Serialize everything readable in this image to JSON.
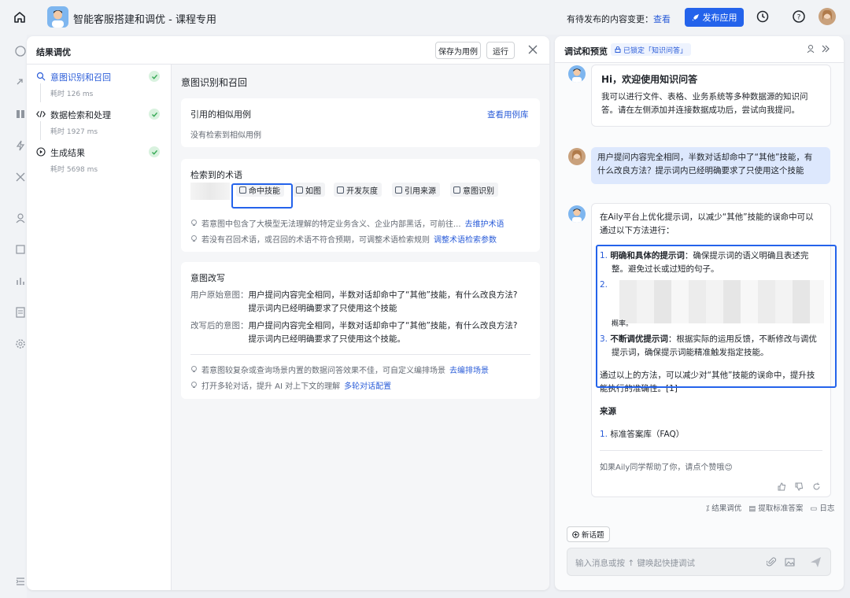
{
  "topbar": {
    "title": "智能客服搭建和调优 - 课程专用",
    "pending_label": "有待发布的内容变更：",
    "pending_link": "查看",
    "publish_label": "发布应用"
  },
  "left": {
    "title": "结果调优",
    "save_case": "保存为用例",
    "run": "运行",
    "steps": [
      {
        "label": "意图识别和召回",
        "time": "耗时 126 ms"
      },
      {
        "label": "数据检索和处理",
        "time": "耗时 1927 ms"
      },
      {
        "label": "生成结果",
        "time": "耗时 5698 ms"
      }
    ],
    "main_title": "意图识别和召回",
    "similar": {
      "title": "引用的相似用例",
      "link": "查看用例库",
      "empty": "没有检索到相似用例"
    },
    "terms": {
      "title": "检索到的术语",
      "tags": [
        "命中技能",
        "如图",
        "开发灰度",
        "引用来源",
        "意图识别"
      ],
      "tip1_text": "若意图中包含了大模型无法理解的特定业务含义、企业内部黑话，可前往...",
      "tip1_link": "去维护术语",
      "tip2_text": "若没有召回术语，或召回的术语不符合预期，可调整术语检索规则",
      "tip2_link": "调整术语检索参数"
    },
    "rewrite": {
      "title": "意图改写",
      "orig_label": "用户原始意图：",
      "orig_line1": "用户提问内容完全相同，半数对话却命中了“其他”技能，有什么改良方法?",
      "orig_line2": "提示词内已经明确要求了只使用这个技能",
      "new_label": "改写后的意图：",
      "new_line1": "用户提问内容完全相同，半数对话却命中了“其他”技能，有什么改良方法?",
      "new_line2": "提示词内已经明确要求了只使用这个技能。",
      "tip1_text": "若意图较复杂或查询场景内置的数据问答效果不佳，可自定义编排场景",
      "tip1_link": "去编排场景",
      "tip2_text": "打开多轮对话，提升 AI 对上下文的理解",
      "tip2_link": "多轮对话配置"
    }
  },
  "right": {
    "title": "调试和预览",
    "badge": "已锁定「知识问答」",
    "welcome_title": "Hi，欢迎使用知识问答",
    "welcome_l1": "我可以进行文件、表格、业务系统等多种数据源的知识问",
    "welcome_l2": "答。请在左侧添加并连接数据成功后，尝试向我提问。",
    "user_l1": "用户提问内容完全相同，半数对话却命中了“其他”技能，有",
    "user_l2": "什么改良方法？提示词内已经明确要求了只使用这个技能",
    "ans_l1": "在Aily平台上优化提示词，以减少“其他”技能的误命中可以",
    "ans_l2": "通过以下方法进行：",
    "item1_num": "1.",
    "item1_bold": "明确和具体的提示词",
    "item1_rest": "：确保提示词的语义明确且表述完",
    "item1_l2": "整。避免过长或过短的句子。",
    "item2_num": "2.",
    "item2_tail": "概率。",
    "item3_num": "3.",
    "item3_bold": "不断调优提示词",
    "item3_rest": "：根据实际的运用反馈，不断修改与调优",
    "item3_l2": "提示词，确保提示词能精准触发指定技能。",
    "concl_l1": "通过以上的方法，可以减少对“其他”技能的误命中，提升技",
    "concl_l2": "能执行的准确性。[1]",
    "source_title": "来源",
    "source_num": "1.",
    "source_item": "标准答案库（FAQ）",
    "like_text": "如果Aily同学帮助了你，请点个赞哦😊",
    "act1": "结果调优",
    "act2": "提取标准答案",
    "act3": "日志",
    "new_topic": "新话题",
    "input_placeholder": "输入消息或按 ↑ 键唤起快捷调试"
  }
}
